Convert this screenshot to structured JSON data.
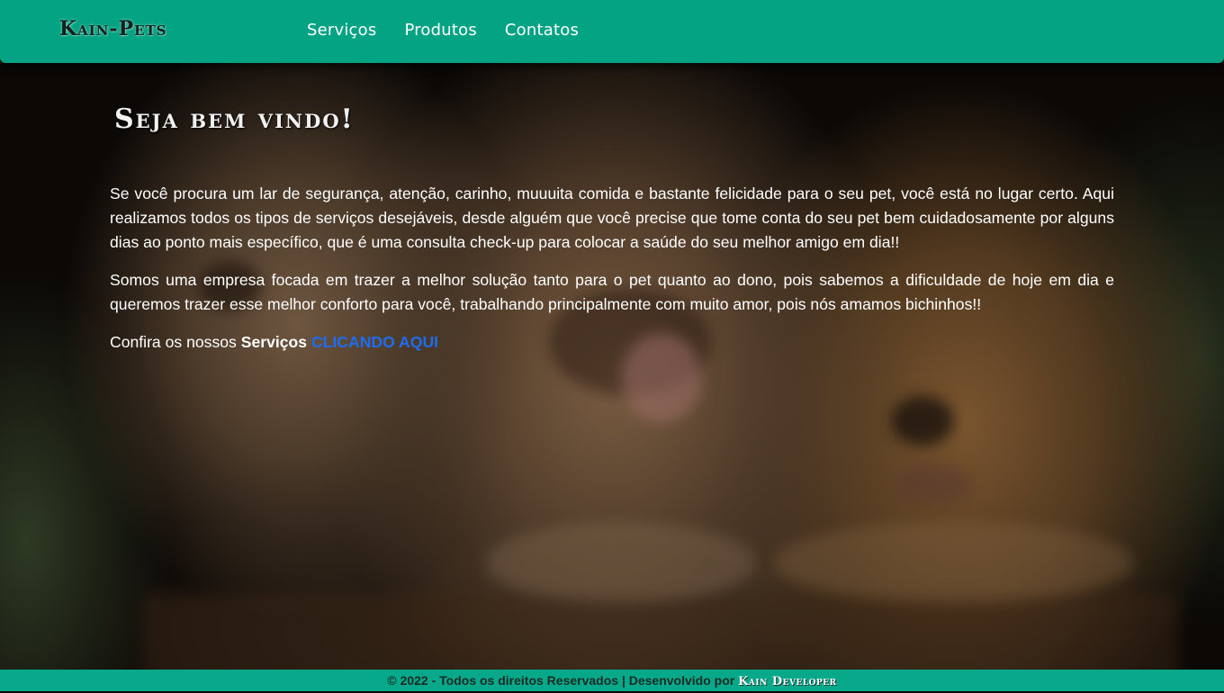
{
  "header": {
    "logo": "Kain-Pets",
    "nav": [
      {
        "label": "Serviços"
      },
      {
        "label": "Produtos"
      },
      {
        "label": "Contatos"
      }
    ]
  },
  "main": {
    "welcome_title": "Seja bem vindo!",
    "paragraph1": "Se você procura um lar de segurança, atenção, carinho, muuuita comida e bastante felicidade para o seu pet, você está no lugar certo. Aqui realizamos todos os tipos de serviços desejáveis, desde alguém que você precise que tome conta do seu pet bem cuidadosamente por alguns dias ao ponto mais específico, que é uma consulta check-up para colocar a saúde do seu melhor amigo em dia!!",
    "paragraph2": "Somos uma empresa focada em trazer a melhor solução tanto para o pet quanto ao dono, pois sabemos a dificuldade de hoje em dia e queremos trazer esse melhor conforto para você, trabalhando principalmente com muito amor, pois nós amamos bichinhos!!",
    "cta_prefix": "Confira os nossos",
    "cta_bold": "Serviços",
    "cta_link": "CLICANDO AQUI"
  },
  "footer": {
    "text": "© 2022 - Todos os direitos Reservados | Desenvolvido por",
    "brand": "Kain Developer"
  },
  "colors": {
    "header_bg": "#04a383",
    "footer_bg": "#07a98a",
    "link": "#1e6cf0",
    "text": "#ffffff"
  }
}
